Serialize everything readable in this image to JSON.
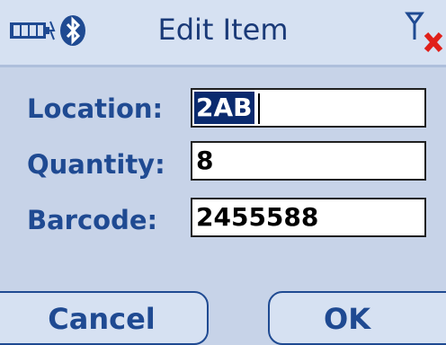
{
  "status": {
    "battery_icon": "battery-icon",
    "bluetooth_icon": "bluetooth-icon",
    "signal_icon": "no-signal-icon"
  },
  "title": "Edit Item",
  "form": {
    "location_label": "Location:",
    "location_value": "2AB",
    "quantity_label": "Quantity:",
    "quantity_value": "8",
    "barcode_label": "Barcode:",
    "barcode_value": "2455588"
  },
  "softkeys": {
    "left": "Cancel",
    "right": "OK"
  },
  "colors": {
    "label": "#1f4a92",
    "selection": "#0a2a6e",
    "background": "#c7d3e8"
  }
}
